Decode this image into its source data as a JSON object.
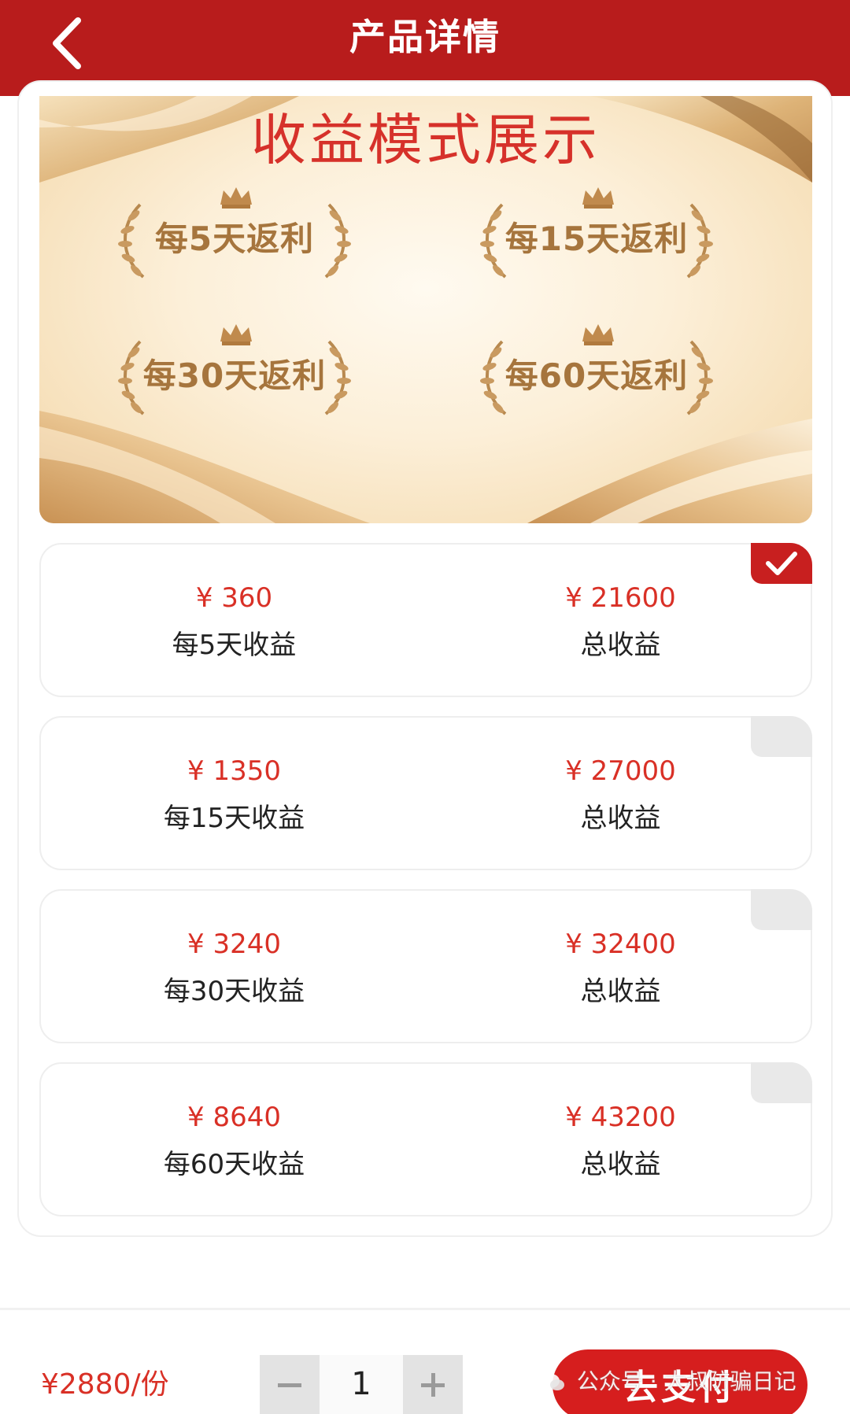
{
  "header": {
    "title": "产品详情",
    "back_icon": "chevron-left-icon"
  },
  "banner": {
    "title": "收益模式展示",
    "awards": [
      "每5天返利",
      "每15天返利",
      "每30天返利",
      "每60天返利"
    ]
  },
  "plans": [
    {
      "amount": "¥ 360",
      "period_label": "每5天收益",
      "total_amount": "¥ 21600",
      "total_label": "总收益",
      "selected": true
    },
    {
      "amount": "¥ 1350",
      "period_label": "每15天收益",
      "total_amount": "¥ 27000",
      "total_label": "总收益",
      "selected": false
    },
    {
      "amount": "¥ 3240",
      "period_label": "每30天收益",
      "total_amount": "¥ 32400",
      "total_label": "总收益",
      "selected": false
    },
    {
      "amount": "¥ 8640",
      "period_label": "每60天收益",
      "total_amount": "¥ 43200",
      "total_label": "总收益",
      "selected": false
    }
  ],
  "footer": {
    "price": "¥2880/份",
    "quantity": "1",
    "pay_label": "去支付",
    "watermark": "公众号 · 大叔防骗日记"
  },
  "colors": {
    "brand_red": "#b81c1c",
    "price_red": "#d93026",
    "gold_text": "#a6753d"
  }
}
